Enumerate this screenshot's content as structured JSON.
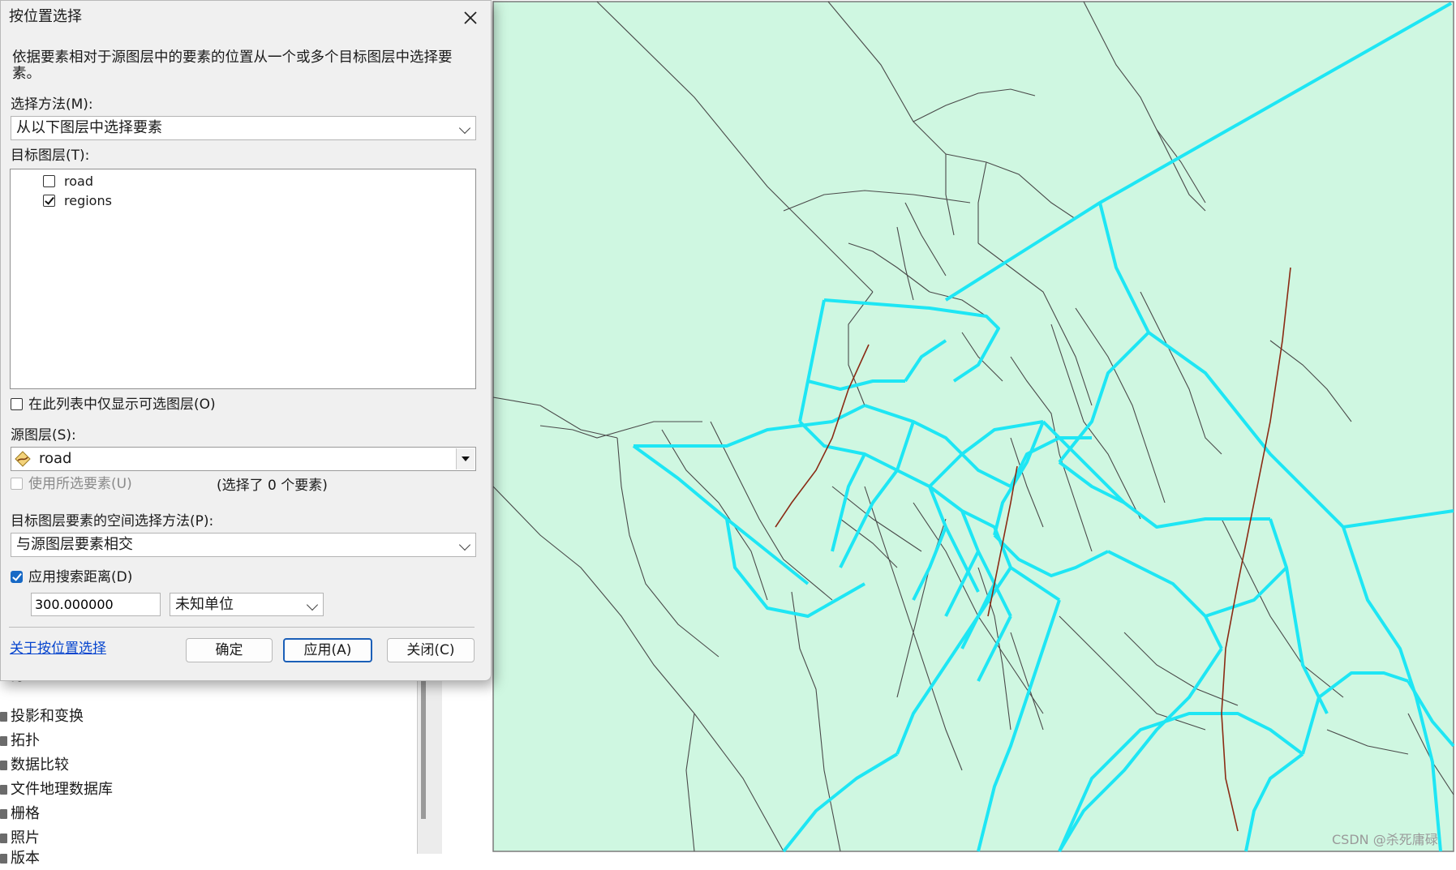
{
  "dialog": {
    "title": "按位置选择",
    "description": "依据要素相对于源图层中的要素的位置从一个或多个目标图层中选择要素。",
    "method_label": "选择方法(M):",
    "method_value": "从以下图层中选择要素",
    "target_layers_label": "目标图层(T):",
    "target_layers": [
      {
        "name": "road",
        "checked": false
      },
      {
        "name": "regions",
        "checked": true
      }
    ],
    "only_selectable_label": "在此列表中仅显示可选图层(O)",
    "source_layer_label": "源图层(S):",
    "source_layer_value": "road",
    "use_selected_label": "使用所选要素(U)",
    "selected_count_text": "(选择了 0 个要素)",
    "spatial_method_label": "目标图层要素的空间选择方法(P):",
    "spatial_method_value": "与源图层要素相交",
    "search_distance_label": "应用搜索距离(D)",
    "search_distance_value": "300.000000",
    "unit_value": "未知单位",
    "help_link": "关于按位置选择",
    "ok_button": "确定",
    "apply_button": "应用(A)",
    "close_button": "关闭(C)"
  },
  "toolbox": {
    "items": [
      "打包",
      "投影和变换",
      "拓扑",
      "数据比较",
      "文件地理数据库",
      "栅格",
      "照片",
      "版本"
    ]
  },
  "map": {
    "background_color": "#cff7e1",
    "selected_color": "#1ee6f4",
    "road_color": "#8a2b14",
    "boundary_color": "#4a4a4a"
  },
  "watermark": "CSDN @杀死庸碌"
}
